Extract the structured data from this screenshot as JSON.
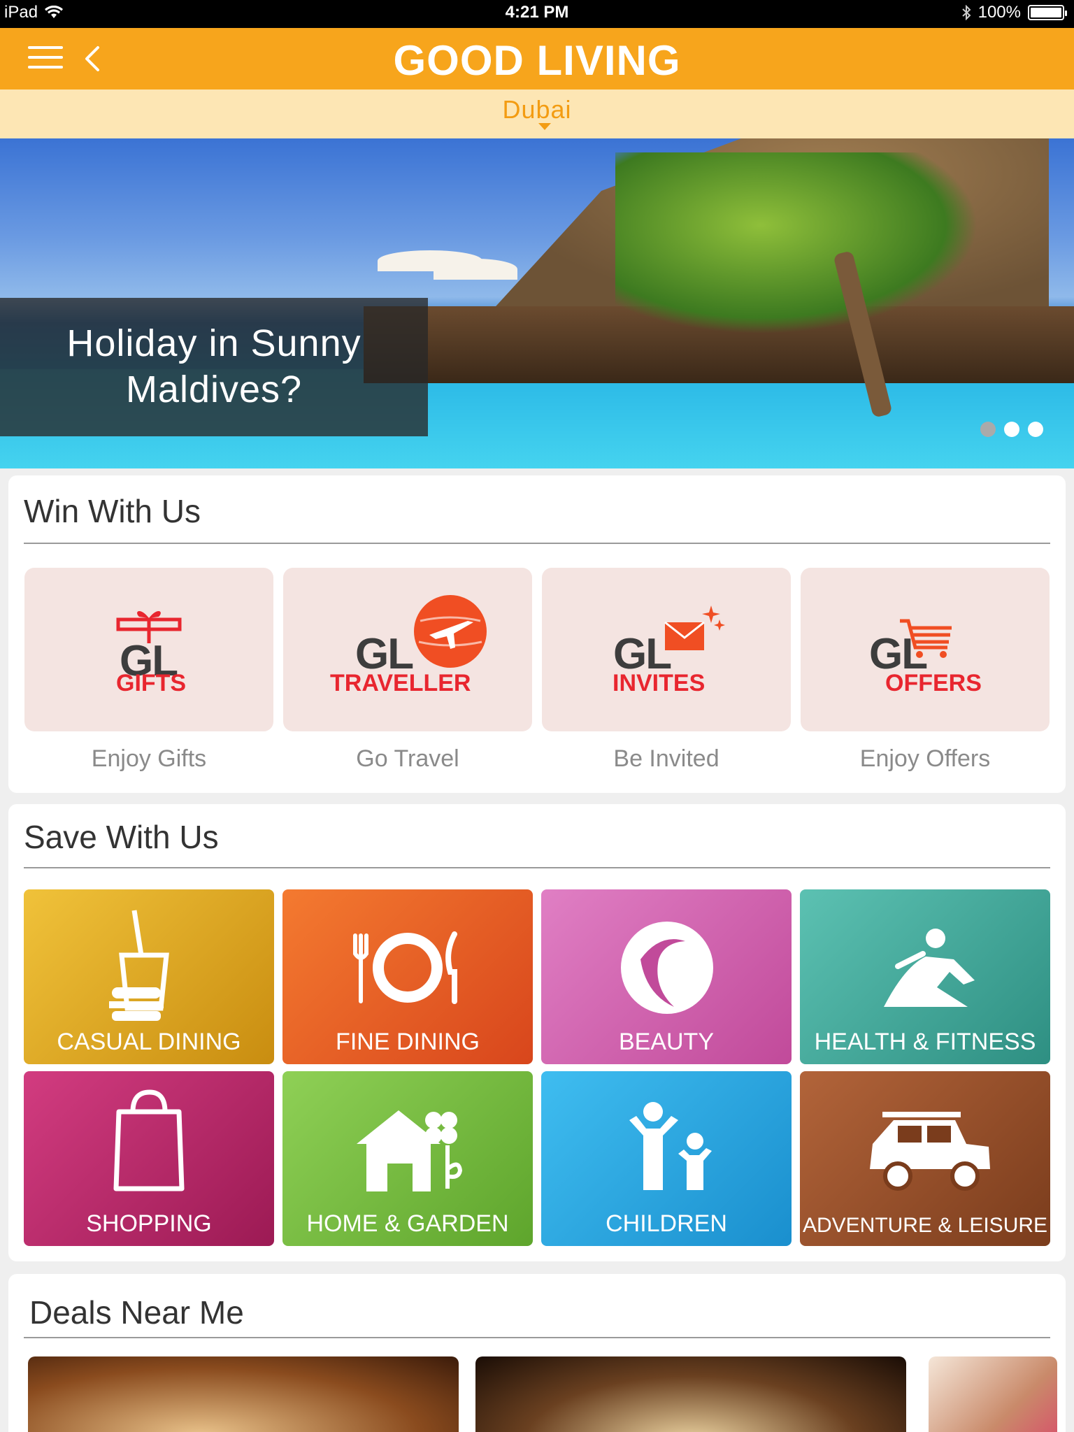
{
  "status": {
    "device": "iPad",
    "time": "4:21 PM",
    "battery": "100%"
  },
  "nav": {
    "title": "GOOD LIVING",
    "city": "Dubai"
  },
  "hero": {
    "caption_line1": "Holiday in Sunny",
    "caption_line2": "Maldives?",
    "slides": 3,
    "active_slide": 1
  },
  "win": {
    "heading": "Win With Us",
    "items": [
      {
        "gl": "GL",
        "sub": "GIFTS",
        "label": "Enjoy Gifts"
      },
      {
        "gl": "GL",
        "sub": "TRAVELLER",
        "label": "Go Travel"
      },
      {
        "gl": "GL",
        "sub": "INVITES",
        "label": "Be Invited"
      },
      {
        "gl": "GL",
        "sub": "OFFERS",
        "label": "Enjoy Offers"
      }
    ]
  },
  "save": {
    "heading": "Save With Us",
    "items": [
      {
        "label": "CASUAL DINING",
        "color": "#e6b21a",
        "icon": "burger-drink-icon"
      },
      {
        "label": "FINE DINING",
        "color": "#f0632a",
        "icon": "plate-cutlery-icon"
      },
      {
        "label": "BEAUTY",
        "color": "#d55fb0",
        "icon": "woman-face-icon"
      },
      {
        "label": "HEALTH & FITNESS",
        "color": "#3fb0a0",
        "icon": "runner-icon"
      },
      {
        "label": "SHOPPING",
        "color": "#c2266d",
        "icon": "shopping-bag-icon"
      },
      {
        "label": "HOME & GARDEN",
        "color": "#7cc244",
        "icon": "house-flower-icon"
      },
      {
        "label": "CHILDREN",
        "color": "#25a8e0",
        "icon": "children-icon"
      },
      {
        "label": "ADVENTURE & LEISURE",
        "color": "#a0522d",
        "icon": "jeep-icon"
      }
    ]
  },
  "deals": {
    "heading": "Deals Near Me"
  }
}
